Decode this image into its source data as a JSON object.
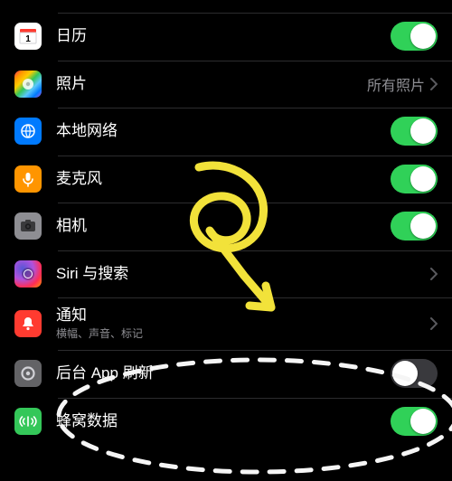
{
  "rows": {
    "top": {
      "label": ""
    },
    "calendar": {
      "label": "日历"
    },
    "photos": {
      "label": "照片",
      "detail": "所有照片"
    },
    "localnet": {
      "label": "本地网络"
    },
    "mic": {
      "label": "麦克风"
    },
    "camera": {
      "label": "相机"
    },
    "siri": {
      "label": "Siri 与搜索"
    },
    "notif": {
      "label": "通知",
      "sub": "横幅、声音、标记"
    },
    "bgrefresh": {
      "label": "后台 App 刷新"
    },
    "cellular": {
      "label": "蜂窝数据"
    }
  },
  "toggles": {
    "calendar": true,
    "localnet": true,
    "mic": true,
    "camera": true,
    "bgrefresh": false,
    "cellular": true
  }
}
